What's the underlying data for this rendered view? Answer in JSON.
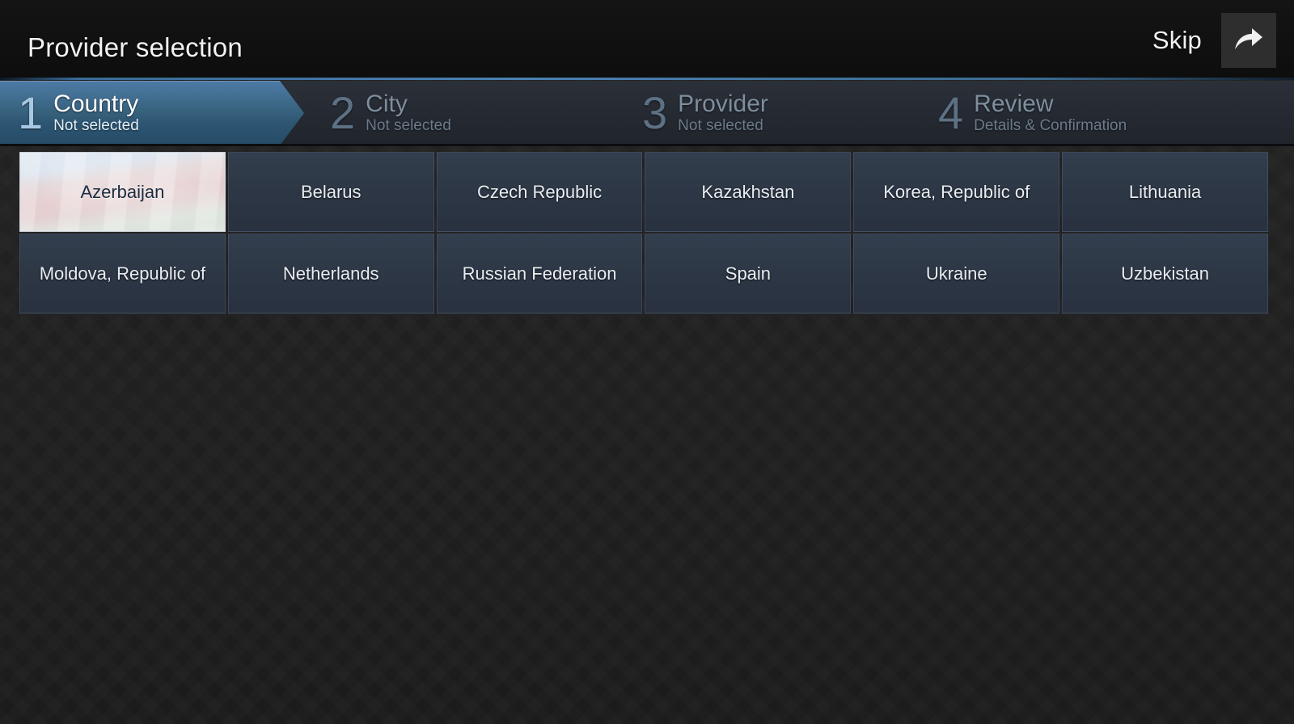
{
  "header": {
    "title": "Provider selection",
    "skip_label": "Skip",
    "forward_icon": "forward-arrow-icon"
  },
  "steps": [
    {
      "number": "1",
      "label": "Country",
      "sub": "Not selected",
      "state": "active"
    },
    {
      "number": "2",
      "label": "City",
      "sub": "Not selected",
      "state": "inactive"
    },
    {
      "number": "3",
      "label": "Provider",
      "sub": "Not selected",
      "state": "inactive"
    },
    {
      "number": "4",
      "label": "Review",
      "sub": "Details & Confirmation",
      "state": "inactive"
    }
  ],
  "countries": [
    {
      "name": "Azerbaijan",
      "selected": true
    },
    {
      "name": "Belarus",
      "selected": false
    },
    {
      "name": "Czech Republic",
      "selected": false
    },
    {
      "name": "Kazakhstan",
      "selected": false
    },
    {
      "name": "Korea, Republic of",
      "selected": false
    },
    {
      "name": "Lithuania",
      "selected": false
    },
    {
      "name": "Moldova, Republic of",
      "selected": false
    },
    {
      "name": "Netherlands",
      "selected": false
    },
    {
      "name": "Russian Federation",
      "selected": false
    },
    {
      "name": "Spain",
      "selected": false
    },
    {
      "name": "Ukraine",
      "selected": false
    },
    {
      "name": "Uzbekistan",
      "selected": false
    }
  ],
  "colors": {
    "accent": "#4d87bb",
    "active_step": "#38637f",
    "cell": "#2c3644",
    "background": "#242424"
  }
}
